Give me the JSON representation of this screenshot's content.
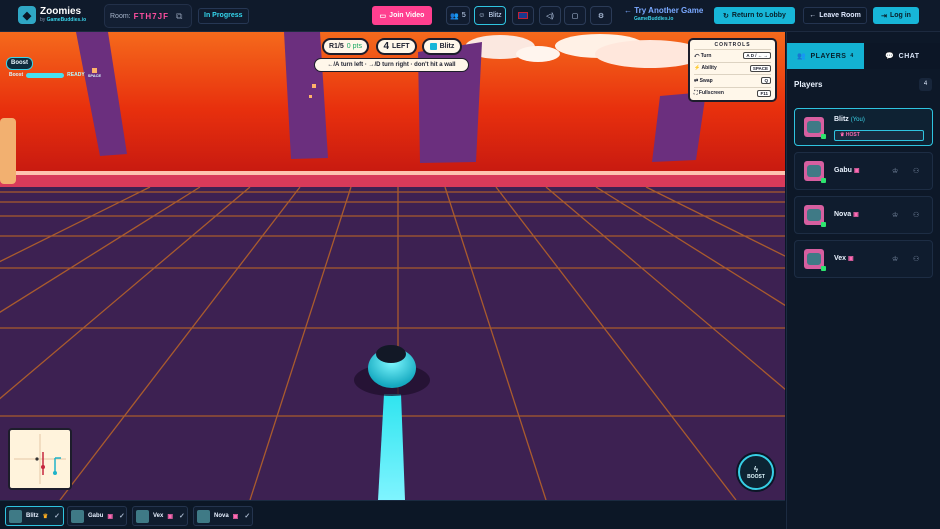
{
  "brand": {
    "name": "Zoomies",
    "by_prefix": "by ",
    "by_name": "GameBuddies.io"
  },
  "room": {
    "label": "Room:",
    "code": "FTH7JF"
  },
  "status": "In Progress",
  "toolbar": {
    "join_video": "Join Video",
    "player_count": "5",
    "current_player": "Blitz",
    "try_another": "Try Another Game",
    "try_sub": "GameBuddies.io",
    "return_lobby": "Return to Lobby",
    "leave_room": "Leave Room",
    "login": "Log in"
  },
  "hud": {
    "round": "R1/5",
    "points": "0 pts",
    "left_count": "4",
    "left_label": "LEFT",
    "player": "Blitz",
    "hint": "←/A turn left · →/D turn right · don't hit a wall",
    "boost_label": "Boost",
    "boost_name": "Boost",
    "boost_ready": "READY",
    "boost_key": "SPACE",
    "boost_fill": 1.0,
    "boost_button": "BOOST"
  },
  "controls": {
    "title": "CONTROLS",
    "rows": [
      {
        "icon": "turn-icon",
        "label": "Turn",
        "key": "A D / ← →"
      },
      {
        "icon": "ability-icon",
        "label": "Ability",
        "key": "SPACE"
      },
      {
        "icon": "swap-icon",
        "label": "Swap",
        "key": "Q"
      },
      {
        "icon": "fullscreen-icon",
        "label": "Fullscreen",
        "key": "F11"
      }
    ]
  },
  "bottom_players": [
    {
      "name": "Blitz",
      "active": true
    },
    {
      "name": "Gabu",
      "active": false
    },
    {
      "name": "Vex",
      "active": false
    },
    {
      "name": "Nova",
      "active": false
    }
  ],
  "sidebar": {
    "tab_players": "PLAYERS",
    "tab_players_count": "4",
    "tab_chat": "CHAT",
    "header": "Players",
    "count": "4",
    "players": [
      {
        "name": "Blitz",
        "tag": "(You)",
        "badge": "HOST"
      },
      {
        "name": "Gabu"
      },
      {
        "name": "Nova"
      },
      {
        "name": "Vex"
      }
    ]
  },
  "colors": {
    "accent_cyan": "#17b6d8",
    "accent_pink": "#ff3f8f",
    "sky_red": "#e8320c",
    "floor_purple": "#3d2152",
    "grid_orange": "#b5622a"
  }
}
